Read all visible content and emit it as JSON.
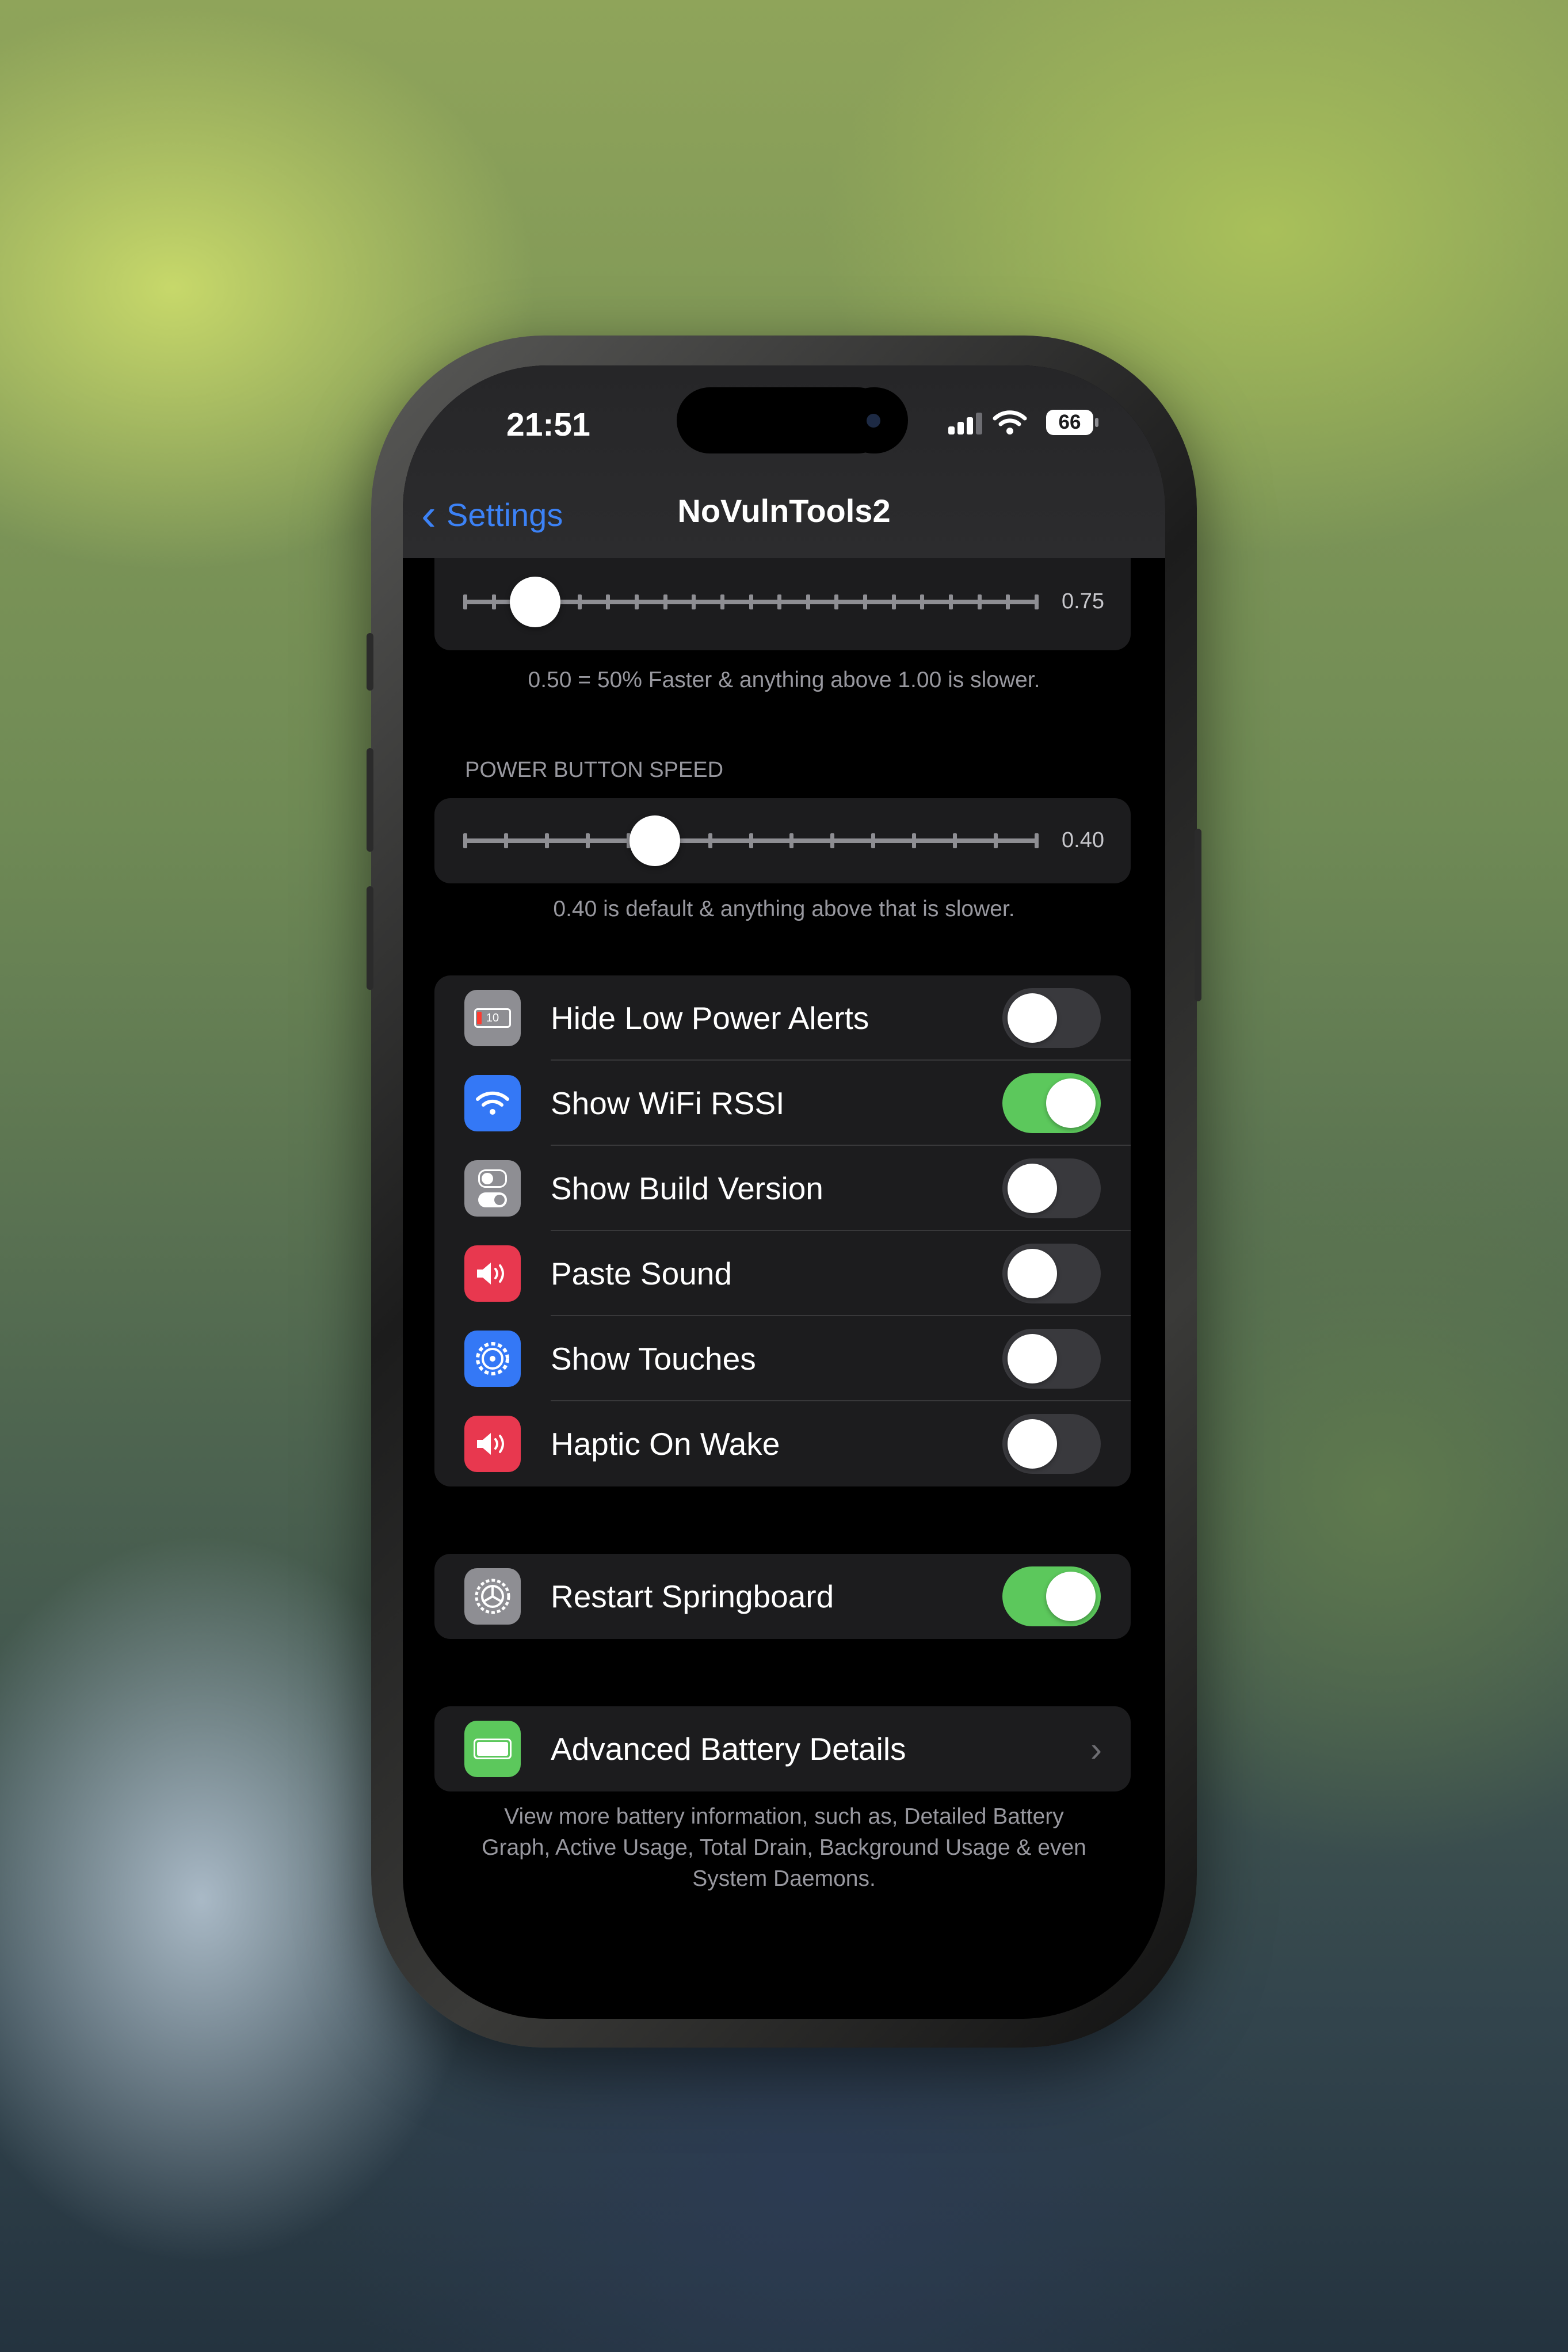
{
  "status_bar": {
    "time": "21:51",
    "battery": "66"
  },
  "nav": {
    "back_label": "Settings",
    "title": "NoVulnTools2"
  },
  "slider_1": {
    "value_text": "0.75",
    "value": 0.75,
    "footer": "0.50 = 50% Faster & anything above 1.00 is slower."
  },
  "slider_2": {
    "header": "POWER BUTTON SPEED",
    "value_text": "0.40",
    "value": 0.4,
    "footer": "0.40 is default & anything above that is slower."
  },
  "toggles": [
    {
      "label": "Hide Low Power Alerts",
      "on": false,
      "icon": "battery-low-icon",
      "icon_color": "#8e8e93",
      "icon_text": "10"
    },
    {
      "label": "Show WiFi RSSI",
      "on": true,
      "icon": "wifi-icon",
      "icon_color": "#3478f6"
    },
    {
      "label": "Show Build Version",
      "on": false,
      "icon": "switches-icon",
      "icon_color": "#8e8e93"
    },
    {
      "label": "Paste Sound",
      "on": false,
      "icon": "speaker-icon",
      "icon_color": "#e8384f"
    },
    {
      "label": "Show Touches",
      "on": false,
      "icon": "gear-icon",
      "icon_color": "#3478f6"
    },
    {
      "label": "Haptic On Wake",
      "on": false,
      "icon": "speaker-icon",
      "icon_color": "#e8384f"
    }
  ],
  "restart": {
    "label": "Restart Springboard",
    "on": true,
    "icon": "settings-gear-icon",
    "icon_color": "#8e8e93"
  },
  "battery_details": {
    "label": "Advanced Battery Details",
    "icon": "battery-full-icon",
    "icon_color": "#5cc85c",
    "footer": "View more battery information, such as, Detailed Battery Graph, Active Usage, Total Drain, Background Usage & even System Daemons."
  },
  "colors": {
    "accent": "#3c82f6",
    "toggle_on": "#5cc85c",
    "group_bg": "#1c1c1e"
  }
}
